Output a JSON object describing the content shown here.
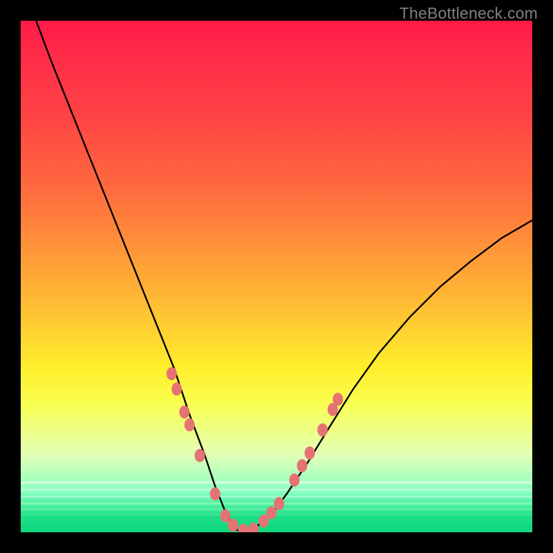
{
  "watermark": "TheBottleneck.com",
  "chart_data": {
    "type": "line",
    "title": "",
    "xlabel": "",
    "ylabel": "",
    "xlim": [
      0,
      100
    ],
    "ylim": [
      0,
      100
    ],
    "grid": false,
    "legend": false,
    "series": [
      {
        "name": "bottleneck-curve",
        "x": [
          3,
          6,
          10,
          14,
          18,
          22,
          26,
          30,
          33,
          36,
          38,
          40,
          41.5,
          43,
          46,
          49,
          52,
          56,
          60,
          65,
          70,
          76,
          82,
          88,
          94,
          100
        ],
        "y": [
          100,
          92,
          82,
          72,
          62,
          52,
          42,
          32,
          23,
          15,
          9,
          4,
          1,
          0,
          1,
          3.5,
          7.5,
          13.5,
          20,
          28,
          35,
          42,
          48,
          53,
          57.5,
          61
        ]
      }
    ],
    "markers": {
      "name": "highlight-dots",
      "points": [
        {
          "x": 29.5,
          "y": 31.0
        },
        {
          "x": 30.5,
          "y": 28.0
        },
        {
          "x": 32.0,
          "y": 23.5
        },
        {
          "x": 33.0,
          "y": 21.0
        },
        {
          "x": 35.0,
          "y": 15.0
        },
        {
          "x": 38.0,
          "y": 7.5
        },
        {
          "x": 40.0,
          "y": 3.2
        },
        {
          "x": 41.5,
          "y": 1.4
        },
        {
          "x": 43.5,
          "y": 0.4
        },
        {
          "x": 45.5,
          "y": 0.6
        },
        {
          "x": 47.5,
          "y": 2.2
        },
        {
          "x": 49.0,
          "y": 3.8
        },
        {
          "x": 50.5,
          "y": 5.6
        },
        {
          "x": 53.5,
          "y": 10.2
        },
        {
          "x": 55.0,
          "y": 13.0
        },
        {
          "x": 56.5,
          "y": 15.5
        },
        {
          "x": 59.0,
          "y": 20.0
        },
        {
          "x": 61.0,
          "y": 24.0
        },
        {
          "x": 62.0,
          "y": 26.0
        }
      ]
    },
    "gradient_background": {
      "orientation": "vertical",
      "stops": [
        {
          "pos": 0.0,
          "color": "#ff1a48"
        },
        {
          "pos": 0.35,
          "color": "#ff8a3a"
        },
        {
          "pos": 0.68,
          "color": "#fff02c"
        },
        {
          "pos": 0.9,
          "color": "#a6ffb8"
        },
        {
          "pos": 1.0,
          "color": "#10d880"
        }
      ]
    }
  }
}
